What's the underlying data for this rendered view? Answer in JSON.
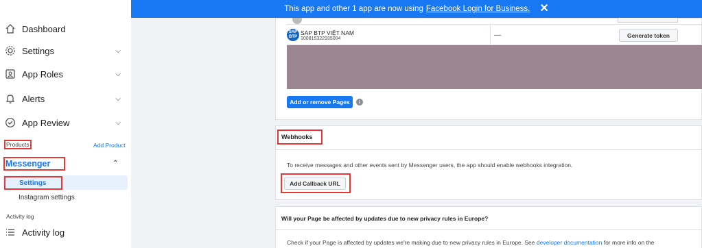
{
  "banner": {
    "text": "This app and other 1 app are now using",
    "link": "Facebook Login for Business.",
    "close": "✕"
  },
  "sidebar": {
    "dashboard": "Dashboard",
    "settings": "Settings",
    "app_roles": "App Roles",
    "alerts": "Alerts",
    "app_review": "App Review",
    "products_label": "Products",
    "add_product": "Add Product",
    "messenger": "Messenger",
    "messenger_settings": "Settings",
    "instagram_settings": "Instagram settings",
    "activity_log_label": "Activity log",
    "activity_log": "Activity log"
  },
  "pages_table": {
    "rows": [
      {
        "avatar_text": "SAP\nBTP",
        "name": "SAP BTP VIỆT NAM",
        "id": "100815322935004",
        "token_value": "—",
        "action": "Generate token"
      }
    ],
    "add_remove_pages": "Add or remove Pages",
    "info_icon": "i"
  },
  "webhooks": {
    "title": "Webhooks",
    "description": "To receive messages and other events sent by Messenger users, the app should enable webhooks integration.",
    "add_callback": "Add Callback URL"
  },
  "privacy": {
    "title": "Will your Page be affected by updates due to new privacy rules in Europe?",
    "text_before": "Check if your Page is affected by updates we're making due to new privacy rules in Europe. See",
    "link": "developer documentation",
    "text_after": "for more info on the"
  },
  "colors": {
    "accent": "#1877f2",
    "highlight_box": "#e53935",
    "redacted": "#9b8591"
  }
}
